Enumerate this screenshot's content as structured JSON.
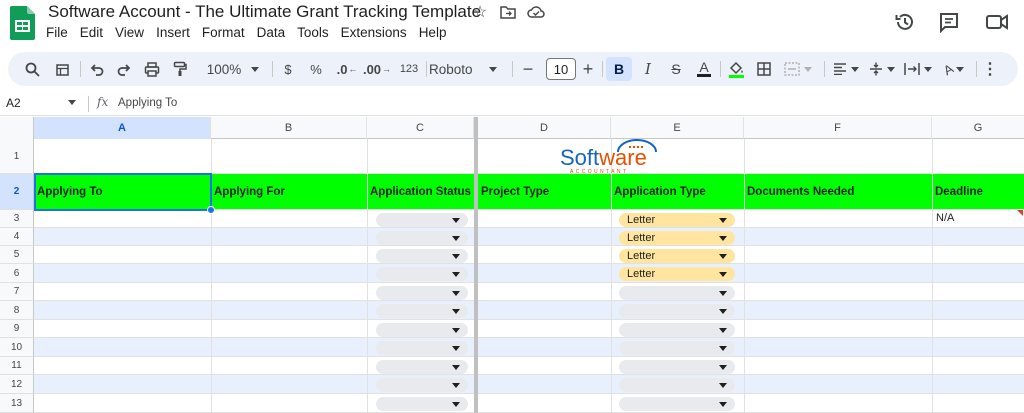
{
  "doc": {
    "title": "Software Account - The Ultimate Grant Tracking Template",
    "menu": [
      "File",
      "Edit",
      "View",
      "Insert",
      "Format",
      "Data",
      "Tools",
      "Extensions",
      "Help"
    ]
  },
  "toolbar": {
    "zoom": "100%",
    "currency": "$",
    "percent": "%",
    "decrease_decimal": ".0",
    "increase_decimal": ".00",
    "number_format": "123",
    "font": "Roboto",
    "font_size": "10",
    "bold": "B",
    "italic": "I",
    "strike": "S",
    "text_color": "A"
  },
  "formula_bar": {
    "name_box": "A2",
    "fx": "fx",
    "content": "Applying To"
  },
  "columns": [
    "A",
    "B",
    "C",
    "D",
    "E",
    "F",
    "G"
  ],
  "rows": [
    "1",
    "2",
    "3",
    "4",
    "5",
    "6",
    "7",
    "8",
    "9",
    "10",
    "11",
    "12",
    "13"
  ],
  "logo": {
    "main_a": "Soft",
    "main_b": "ware",
    "sub": "ACCOUNTANT"
  },
  "header_row": {
    "applying_to": "Applying To",
    "applying_for": "Applying For",
    "application_status": "Application Status",
    "project_type": "Project Type",
    "application_type": "Application Type",
    "documents_needed": "Documents  Needed",
    "deadline": "Deadline"
  },
  "cells": {
    "g3": "N/A",
    "e3": "Letter",
    "e4": "Letter",
    "e5": "Letter",
    "e6": "Letter"
  },
  "colors": {
    "header_green": "#00ff00",
    "band": "#e8f0fe",
    "chip_letter": "#ffe59f",
    "chip_empty": "#e8eaed",
    "selection": "#1a73e8"
  }
}
